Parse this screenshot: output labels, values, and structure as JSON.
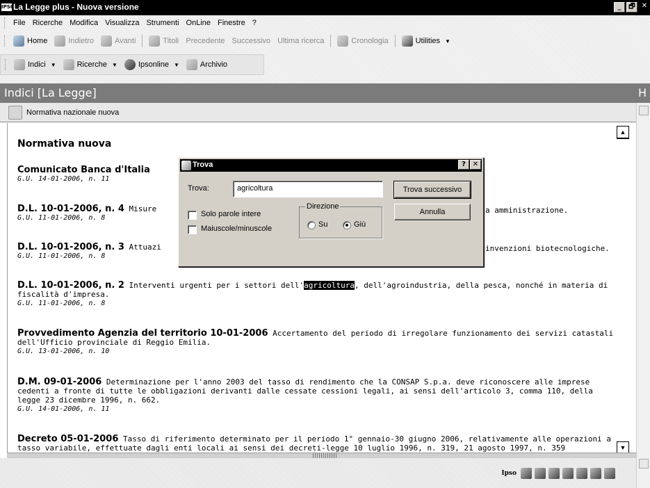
{
  "window": {
    "title": "La Legge plus - Nuova versione",
    "logo": "IPSO",
    "controls": [
      "_",
      "🗗",
      "✕"
    ]
  },
  "menu": [
    "File",
    "Ricerche",
    "Modifica",
    "Visualizza",
    "Strumenti",
    "OnLine",
    "Finestre",
    "?"
  ],
  "toolbar": {
    "home": "Home",
    "back": "Indietro",
    "forward": "Avanti",
    "titles": "Titoli",
    "previous": "Precedente",
    "next": "Successivo",
    "last_search": "Ultima ricerca",
    "history": "Cronologia",
    "utilities": "Utilities"
  },
  "toolbar2": {
    "indexes": "Indici",
    "searches": "Ricerche",
    "ipsonline": "Ipsonline",
    "archive": "Archivio"
  },
  "panel": {
    "header": "Indici [La Legge]",
    "side_header": "H",
    "breadcrumb": "Normativa nazionale nuova"
  },
  "document": {
    "heading": "Normativa nuova",
    "entries": [
      {
        "ref": "Comunicato Banca d'Italia",
        "desc": "",
        "gu": "G.U. 14-01-2006, n. 11"
      },
      {
        "ref": "D.L. 10-01-2006, n. 4",
        "desc": "Misure",
        "desc_tail": "a amministrazione.",
        "gu": "G.U. 11-01-2006, n. 8"
      },
      {
        "ref": "D.L. 10-01-2006, n. 3",
        "desc": "Attuazi",
        "desc_tail": "invenzioni biotecnologiche.",
        "gu": "G.U. 11-01-2006, n. 8"
      },
      {
        "ref": "D.L. 10-01-2006, n. 2",
        "desc_before": "Interventi urgenti per i settori dell'",
        "highlight": "agricoltura",
        "desc_after": ", dell'agroindustria, della pesca, nonché in materia di fiscalità d'impresa.",
        "gu": "G.U. 11-01-2006, n. 8"
      },
      {
        "ref": "Provvedimento Agenzia del territorio 10-01-2006",
        "desc": "Accertamento del periodo di irregolare funzionamento dei servizi catastali dell'Ufficio provinciale di Reggio Emilia.",
        "gu": "G.U. 13-01-2006, n. 10"
      },
      {
        "ref": "D.M. 09-01-2006",
        "desc": "Determinazione per l'anno 2003 del tasso di rendimento che la CONSAP S.p.a. deve riconoscere alle imprese cedenti a fronte di tutte le obbligazioni derivanti dalle cessate cessioni legali, ai sensi dell'articolo 3, comma 110, della legge 23 dicembre 1996, n. 662.",
        "gu": "G.U. 14-01-2006, n. 11"
      },
      {
        "ref": "Decreto 05-01-2006",
        "desc": "Tasso di riferimento determinato per il periodo 1° gennaio-30 giugno 2006, relativamente alle operazioni a tasso variabile, effettuate dagli enti locali ai sensi dei decreti-legge 10 luglio 1996, n. 319, 21 agosto 1997, n. 359",
        "gu": ""
      }
    ]
  },
  "dialog": {
    "title": "Trova",
    "help": "?",
    "close": "✕",
    "find_label": "Trova:",
    "find_value": "agricoltura",
    "find_next": "Trova successivo",
    "cancel": "Annulla",
    "whole_words": "Solo parole intere",
    "match_case": "Maiuscole/minuscole",
    "direction_label": "Direzione",
    "up": "Su",
    "down": "Giù",
    "direction_selected": "Giù",
    "whole_words_checked": false,
    "match_case_checked": false
  },
  "status": {
    "logo": "Ipso"
  },
  "colors": {
    "title_bg": "#000000",
    "header_bg": "#7b7b7b",
    "dialog_bg": "#d4d0c8",
    "highlight": "#000000"
  }
}
